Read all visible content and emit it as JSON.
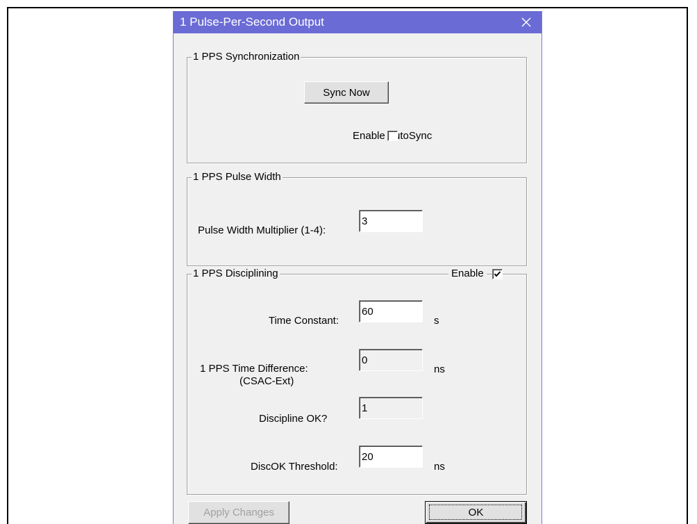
{
  "window": {
    "title": "1 Pulse-Per-Second Output",
    "close_icon": "close-icon"
  },
  "sync_group": {
    "label": "1 PPS Synchronization",
    "sync_now_label": "Sync Now",
    "autosync_label": "Enable AutoSync",
    "autosync_checked": false
  },
  "pulse_group": {
    "label": "1 PPS Pulse Width",
    "multiplier_label": "Pulse Width Multiplier (1-4):",
    "multiplier_value": "3"
  },
  "discipline_group": {
    "label": "1 PPS Disciplining",
    "enable_label": "Enable",
    "enable_checked": true,
    "time_constant_label": "Time Constant:",
    "time_constant_value": "60",
    "time_constant_unit": "s",
    "time_diff_label_line1": "1 PPS Time Difference:",
    "time_diff_label_line2": "(CSAC-Ext)",
    "time_diff_value": "0",
    "time_diff_unit": "ns",
    "discipline_ok_label": "Discipline OK?",
    "discipline_ok_value": "1",
    "threshold_label": "DiscOK Threshold:",
    "threshold_value": "20",
    "threshold_unit": "ns"
  },
  "footer": {
    "apply_label": "Apply Changes",
    "ok_label": "OK"
  },
  "colors": {
    "titlebar": "#6b6bd6",
    "dialog_bg": "#f0f0f0"
  }
}
